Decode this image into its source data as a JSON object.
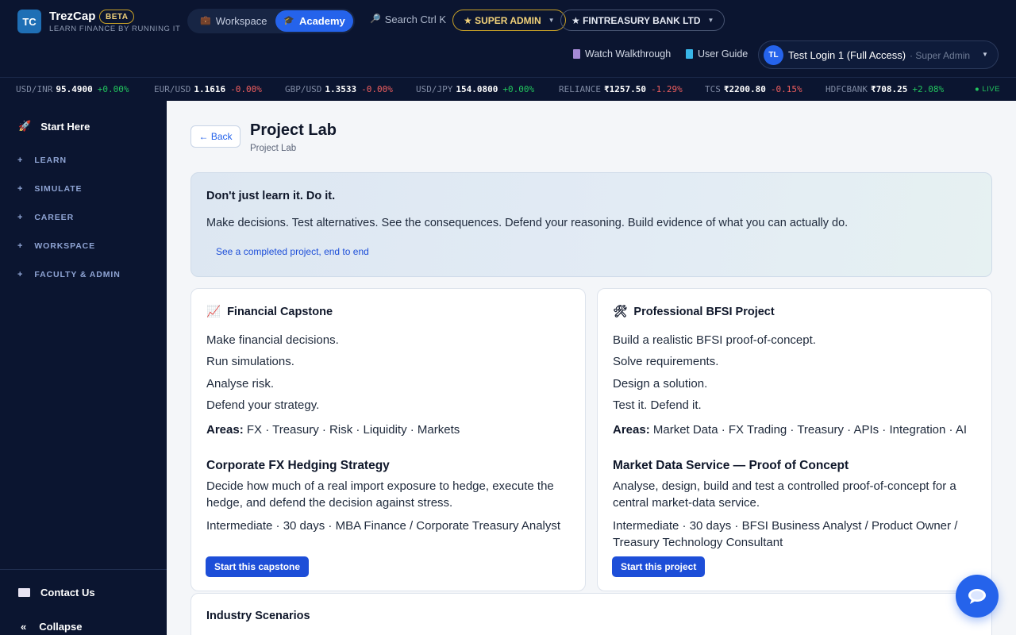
{
  "brand": {
    "logo_text": "TC",
    "name": "TrezCap",
    "badge": "BETA",
    "tagline": "LEARN FINANCE BY RUNNING IT"
  },
  "header": {
    "modes": {
      "workspace": "Workspace",
      "academy": "Academy"
    },
    "search": "Search Ctrl K",
    "role_pill": "★ SUPER ADMIN",
    "bank_pill": "★ FINTREASURY BANK LTD",
    "walkthrough": "Watch Walkthrough",
    "guide": "User Guide",
    "user": {
      "initials": "TL",
      "name": "Test Login 1 (Full Access)",
      "role": "· Super Admin"
    }
  },
  "ticker": {
    "items": [
      {
        "symbol": "USD/INR",
        "price": "95.4900",
        "change": "+0.00%",
        "direction": "up"
      },
      {
        "symbol": "EUR/USD",
        "price": "1.1616",
        "change": "-0.00%",
        "direction": "down"
      },
      {
        "symbol": "GBP/USD",
        "price": "1.3533",
        "change": "-0.00%",
        "direction": "down"
      },
      {
        "symbol": "USD/JPY",
        "price": "154.0800",
        "change": "+0.00%",
        "direction": "up"
      },
      {
        "symbol": "RELIANCE",
        "price": "₹1257.50",
        "change": "-1.29%",
        "direction": "down"
      },
      {
        "symbol": "TCS",
        "price": "₹2200.80",
        "change": "-0.15%",
        "direction": "down"
      },
      {
        "symbol": "HDFCBANK",
        "price": "₹708.25",
        "change": "+2.08%",
        "direction": "up"
      }
    ],
    "live": "● LIVE"
  },
  "sidebar": {
    "start": "Start Here",
    "sections": [
      "LEARN",
      "SIMULATE",
      "CAREER",
      "WORKSPACE",
      "FACULTY & ADMIN"
    ],
    "contact": "Contact Us",
    "collapse": "Collapse"
  },
  "page": {
    "back": "← Back",
    "title": "Project Lab",
    "breadcrumb": "Project Lab",
    "hero": {
      "title": "Don't just learn it. Do it.",
      "text": "Make decisions. Test alternatives. See the consequences. Defend your reasoning. Build evidence of what you can actually do.",
      "link": "See a completed project, end to end"
    },
    "cards": [
      {
        "icon": "📈",
        "title": "Financial Capstone",
        "lines": [
          "Make financial decisions.",
          "Run simulations.",
          "Analyse risk.",
          "Defend your strategy."
        ],
        "areas_label": "Areas:",
        "areas": "FX · Treasury · Risk · Liquidity · Markets",
        "project_title": "Corporate FX Hedging Strategy",
        "project_desc": "Decide how much of a real import exposure to hedge, execute the hedge, and defend the decision against stress.",
        "project_meta": "Intermediate · 30 days · MBA Finance / Corporate Treasury Analyst",
        "button": "Start this capstone"
      },
      {
        "icon": "🛠",
        "title": "Professional BFSI Project",
        "lines": [
          "Build a realistic BFSI proof-of-concept.",
          "Solve requirements.",
          "Design a solution.",
          "Test it. Defend it."
        ],
        "areas_label": "Areas:",
        "areas": "Market Data · FX Trading · Treasury · APIs · Integration · AI",
        "project_title": "Market Data Service — Proof of Concept",
        "project_desc": "Analyse, design, build and test a controlled proof-of-concept for a central market-data service.",
        "project_meta": "Intermediate · 30 days · BFSI Business Analyst / Product Owner / Treasury Technology Consultant",
        "button": "Start this project"
      }
    ],
    "scenarios_title": "Industry Scenarios"
  },
  "colors": {
    "navy": "#0b1530",
    "accent": "#2563eb",
    "gold": "#c9a227",
    "up": "#22c55e",
    "down": "#f25f5f"
  }
}
